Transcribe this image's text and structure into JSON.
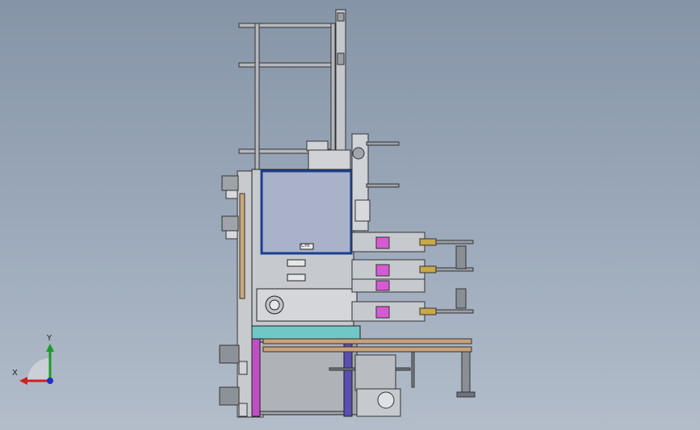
{
  "viewport": {
    "background_top": "#8694a7",
    "background_bottom": "#b3bdca"
  },
  "model": {
    "frame_color": "#b5b8bd",
    "panel_color": "#a9b2c9",
    "panel_border_color": "#1a3f8f",
    "cyan_strip_color": "#6fc8c6",
    "magenta_strip_color": "#c04fc4",
    "purple_strip_color": "#5a4fb0",
    "wood_rail_color": "#c8a27a",
    "pink_part_color": "#d65bd3",
    "brass_part_color": "#c9a84a",
    "door_label": "CHI"
  },
  "triad": {
    "y_label": "Y",
    "x_label": "X",
    "y_color": "#1a9a2a",
    "x_color": "#cc2020",
    "z_color": "#2030c0"
  }
}
